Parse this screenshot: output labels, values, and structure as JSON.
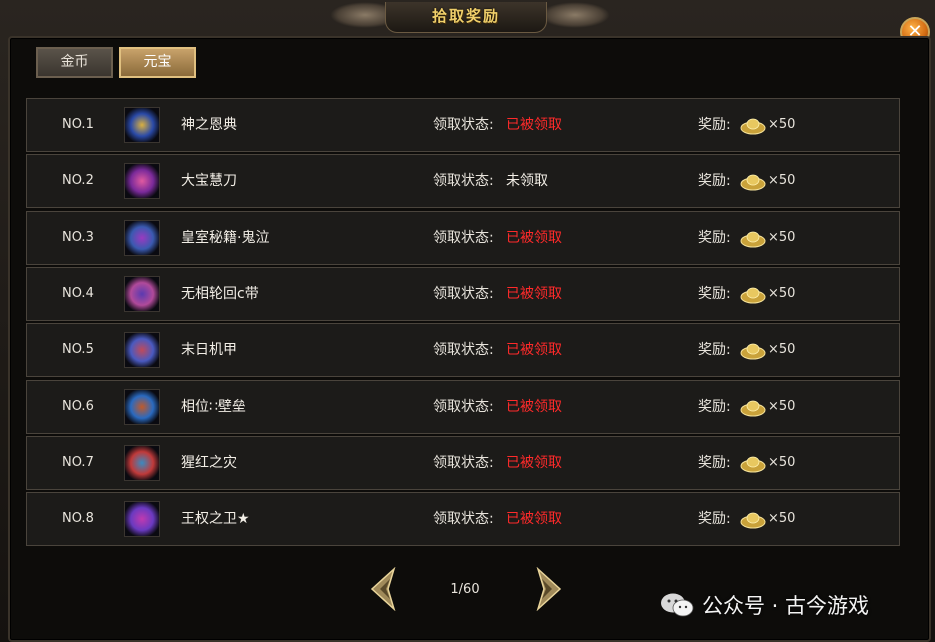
{
  "window": {
    "title": "拾取奖励",
    "close_label": "✕"
  },
  "tabs": [
    {
      "label": "金币",
      "active": false
    },
    {
      "label": "元宝",
      "active": true
    }
  ],
  "rows": [
    {
      "rank": "NO.1",
      "name": "神之恩典",
      "status_label": "领取状态:",
      "status": "已被领取",
      "status_color": "#ff2a2a",
      "reward_label": "奖励:",
      "reward_icon": "gold-ingot-icon",
      "reward_count": "×50",
      "icon_colors": [
        "#2a4aa8",
        "#d9b040"
      ]
    },
    {
      "rank": "NO.2",
      "name": "大宝慧刀",
      "status_label": "领取状态:",
      "status": "未领取",
      "status_color": "#f2eee6",
      "reward_label": "奖励:",
      "reward_icon": "gold-ingot-icon",
      "reward_count": "×50",
      "icon_colors": [
        "#7a2a9a",
        "#e05aa0"
      ]
    },
    {
      "rank": "NO.3",
      "name": "皇室秘籍·鬼泣",
      "status_label": "领取状态:",
      "status": "已被领取",
      "status_color": "#ff2a2a",
      "reward_label": "奖励:",
      "reward_icon": "gold-ingot-icon",
      "reward_count": "×50",
      "icon_colors": [
        "#3a5ab0",
        "#9a3ac0"
      ]
    },
    {
      "rank": "NO.4",
      "name": "无相轮回ⅽ带",
      "status_label": "领取状态:",
      "status": "已被领取",
      "status_color": "#ff2a2a",
      "reward_label": "奖励:",
      "reward_icon": "gold-ingot-icon",
      "reward_count": "×50",
      "icon_colors": [
        "#b04a9a",
        "#5a3ab0"
      ]
    },
    {
      "rank": "NO.5",
      "name": "末日机甲",
      "status_label": "领取状态:",
      "status": "已被领取",
      "status_color": "#ff2a2a",
      "reward_label": "奖励:",
      "reward_icon": "gold-ingot-icon",
      "reward_count": "×50",
      "icon_colors": [
        "#4a5ac0",
        "#c04a5a"
      ]
    },
    {
      "rank": "NO.6",
      "name": "相位∷壁垒",
      "status_label": "领取状态:",
      "status": "已被领取",
      "status_color": "#ff2a2a",
      "reward_label": "奖励:",
      "reward_icon": "gold-ingot-icon",
      "reward_count": "×50",
      "icon_colors": [
        "#2a6ac0",
        "#c05a2a"
      ]
    },
    {
      "rank": "NO.7",
      "name": "猩红之灾",
      "status_label": "领取状态:",
      "status": "已被领取",
      "status_color": "#ff2a2a",
      "reward_label": "奖励:",
      "reward_icon": "gold-ingot-icon",
      "reward_count": "×50",
      "icon_colors": [
        "#c03a3a",
        "#3a8ac0"
      ]
    },
    {
      "rank": "NO.8",
      "name": "王权之卫★",
      "status_label": "领取状态:",
      "status": "已被领取",
      "status_color": "#ff2a2a",
      "reward_label": "奖励:",
      "reward_icon": "gold-ingot-icon",
      "reward_count": "×50",
      "icon_colors": [
        "#6a3ac0",
        "#c03ab0"
      ]
    }
  ],
  "pager": {
    "page_text": "1/60",
    "prev_icon": "prev-arrow-icon",
    "next_icon": "next-arrow-icon"
  },
  "watermark": {
    "text": "公众号 · 古今游戏"
  },
  "colors": {
    "title": "#f0cf6a",
    "claimed": "#ff2a2a",
    "unclaimed": "#f2eee6",
    "row_bg": "#1c1b19"
  }
}
